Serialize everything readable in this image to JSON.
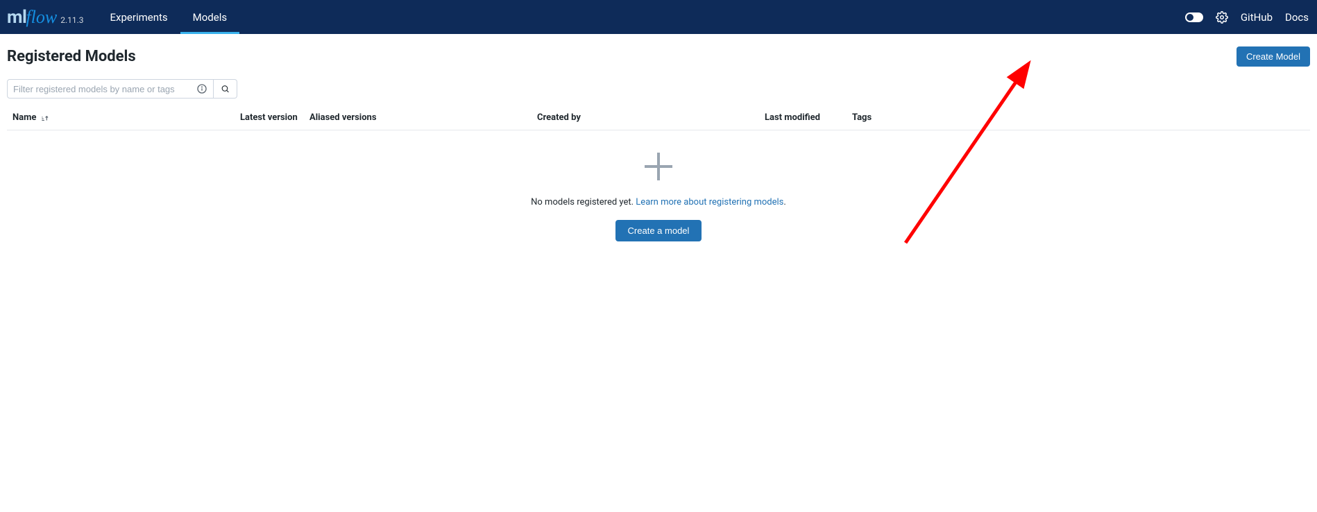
{
  "brand": {
    "ml": "ml",
    "flow": "flow",
    "version": "2.11.3"
  },
  "nav": {
    "experiments": "Experiments",
    "models": "Models"
  },
  "header_links": {
    "github": "GitHub",
    "docs": "Docs"
  },
  "page": {
    "title": "Registered Models",
    "create_button": "Create Model"
  },
  "filter": {
    "placeholder": "Filter registered models by name or tags"
  },
  "columns": {
    "name": "Name",
    "latest_version": "Latest version",
    "aliased_versions": "Aliased versions",
    "created_by": "Created by",
    "last_modified": "Last modified",
    "tags": "Tags"
  },
  "empty": {
    "message_prefix": "No models registered yet. ",
    "link_text": "Learn more about registering models",
    "message_suffix": ".",
    "button": "Create a model"
  }
}
